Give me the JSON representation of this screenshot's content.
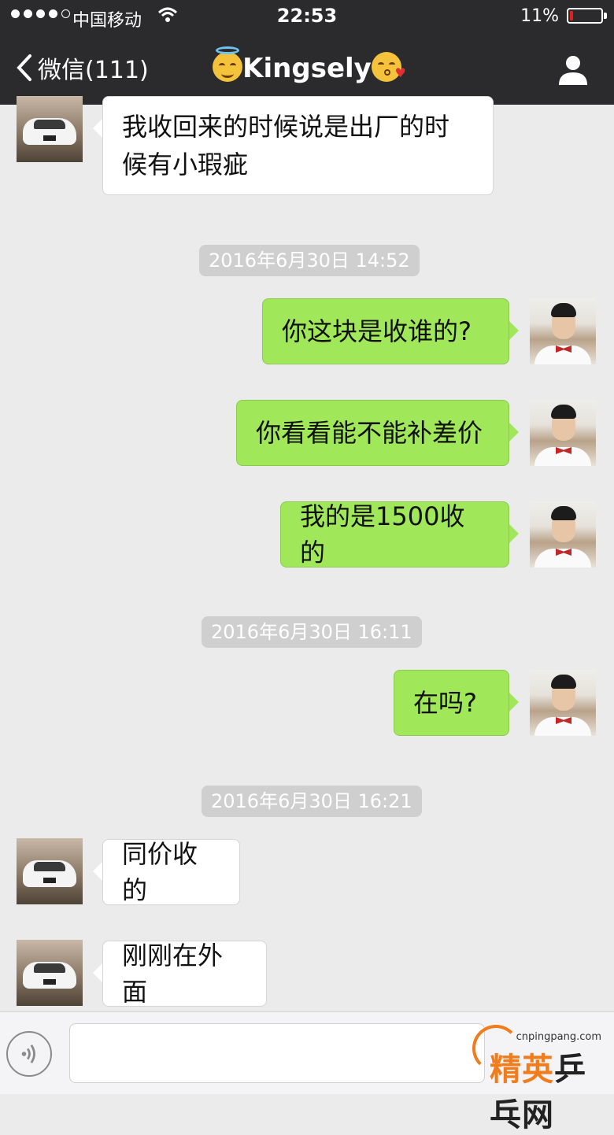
{
  "status_bar": {
    "carrier": "中国移动",
    "time": "22:53",
    "battery_percent": "11%",
    "battery_level": 0.11,
    "battery_color": "#e02020",
    "signal_bars_filled": 4,
    "signal_bars_total": 5
  },
  "nav": {
    "back_label": "微信(111)",
    "title": "Kingsely",
    "title_emoji_left": "smiling-face-with-halo",
    "title_emoji_right": "face-blowing-kiss",
    "profile_icon": "person-icon"
  },
  "messages": [
    {
      "side": "in",
      "text": "我收回来的时候说是出厂的时候有小瑕疵",
      "line1": "我收回来的时候说是出厂的时",
      "line2": "候有小瑕疵"
    },
    {
      "timestamp": "2016年6月30日 14:52"
    },
    {
      "side": "out",
      "text": "你这块是收谁的?"
    },
    {
      "side": "out",
      "text": "你看看能不能补差价"
    },
    {
      "side": "out",
      "text": "我的是1500收的"
    },
    {
      "timestamp": "2016年6月30日 16:11"
    },
    {
      "side": "out",
      "text": "在吗?"
    },
    {
      "timestamp": "2016年6月30日 16:21"
    },
    {
      "side": "in",
      "text": "同价收的"
    },
    {
      "side": "in",
      "text": "刚刚在外面"
    }
  ],
  "input_bar": {
    "voice_icon": "voice-icon",
    "text_value": ""
  },
  "watermark": {
    "url": "cnpingpang.com",
    "text_highlight": "精英",
    "text_rest": "乒乓网"
  },
  "colors": {
    "header_bg": "#2b2b2e",
    "chat_bg": "#ebebeb",
    "outgoing_bubble": "#a0e75a",
    "incoming_bubble": "#ffffff",
    "timestamp_bg": "#cfcfcf",
    "watermark_accent": "#f07c1b"
  }
}
